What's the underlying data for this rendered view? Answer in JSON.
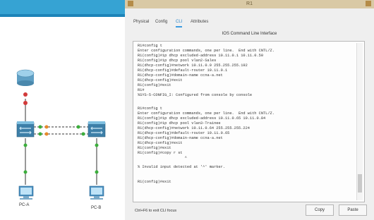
{
  "topology": {
    "pc_left_label": "PC-A",
    "pc_right_label": "PC-B"
  },
  "window": {
    "title": "R1"
  },
  "tabs": [
    {
      "label": "Physical"
    },
    {
      "label": "Config"
    },
    {
      "label": "CLI"
    },
    {
      "label": "Attributes"
    }
  ],
  "panel_title": "IOS Command Line Interface",
  "console_lines": [
    "R1#config t",
    "Enter configuration commands, one per line.  End with CNTL/Z.",
    "R1(config)#ip dhcp excluded-address 10.11.0.1 10.11.0.50",
    "R1(config)#ip dhcp pool vlan2-Sales",
    "R1(dhcp-config)#network 10.11.0.0 255.255.255.192",
    "R1(dhcp-config)#default-router 10.11.0.1",
    "R1(dhcp-config)#domain-name ccna-a.net",
    "R1(dhcp-config)#exit",
    "R1(config)#exit",
    "R1#",
    "%SYS-5-CONFIG_I: Configured from console by console",
    "",
    "R1#config t",
    "Enter configuration commands, one per line.  End with CNTL/Z.",
    "R1(config)#ip dhcp excluded-address 10.11.0.65 10.11.0.84",
    "R1(config)#ip dhcp pool vlan3-Trainee",
    "R1(dhcp-config)#network 10.11.0.64 255.255.255.224",
    "R1(dhcp-config)#default-router 10.11.0.65",
    "R1(dhcp-config)#domain-name ccna-a.net",
    "R1(dhcp-config)#exit",
    "R1(config)#exit",
    "R1(config)#copy r st",
    "                     ^",
    "% Invalid input detected at '^' marker.",
    "",
    "R1(config)#exit"
  ],
  "hint": "Ctrl+F6 to exit CLI focus",
  "buttons": {
    "copy": "Copy",
    "paste": "Paste"
  },
  "colors": {
    "top_bar": "#36a3d3",
    "active_tab": "#2c86c9",
    "link_red": "#d23b3b",
    "link_green": "#3cae3c",
    "link_orange": "#e98a2a"
  }
}
